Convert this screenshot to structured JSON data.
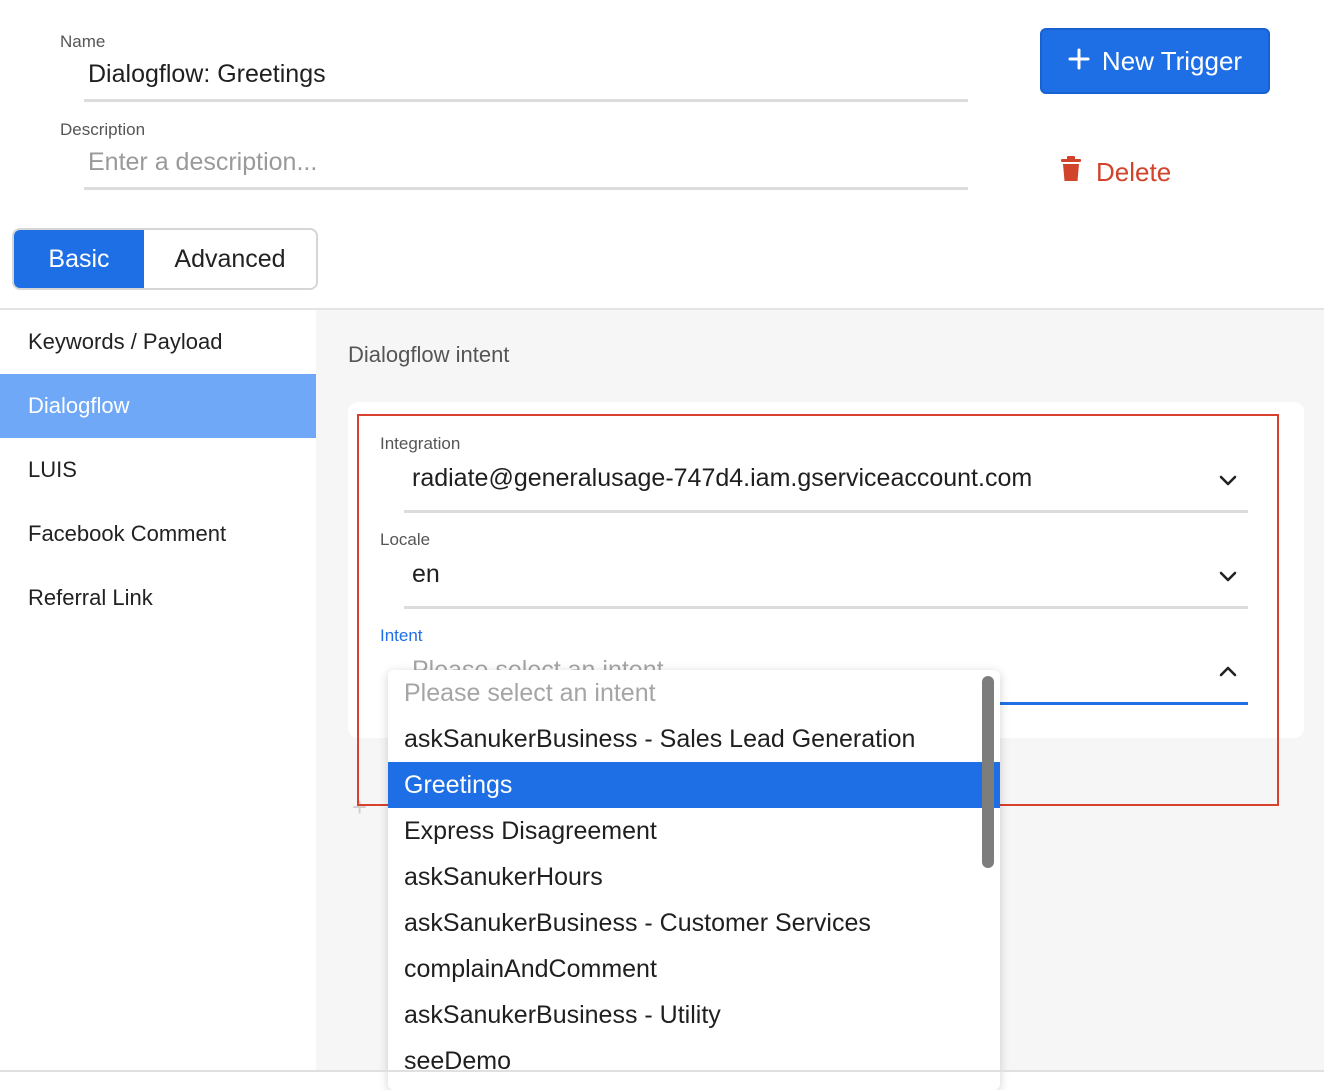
{
  "form": {
    "name_label": "Name",
    "name_value": "Dialogflow: Greetings",
    "description_label": "Description",
    "description_placeholder": "Enter a description..."
  },
  "actions": {
    "new_trigger_label": "New Trigger",
    "delete_label": "Delete"
  },
  "mode_tabs": {
    "basic": "Basic",
    "advanced": "Advanced",
    "selected": "Basic"
  },
  "sidebar": {
    "items": [
      {
        "label": "Keywords / Payload",
        "active": false
      },
      {
        "label": "Dialogflow",
        "active": true
      },
      {
        "label": "LUIS",
        "active": false
      },
      {
        "label": "Facebook Comment",
        "active": false
      },
      {
        "label": "Referral Link",
        "active": false
      }
    ]
  },
  "main": {
    "section_title": "Dialogflow intent",
    "integration": {
      "label": "Integration",
      "value": "radiate@generalusage-747d4.iam.gserviceaccount.com"
    },
    "locale": {
      "label": "Locale",
      "value": "en"
    },
    "intent": {
      "label": "Intent",
      "placeholder": "Please select an intent",
      "options": [
        "Please select an intent",
        "askSanukerBusiness - Sales Lead Generation",
        "Greetings",
        "Express Disagreement",
        "askSanukerHours",
        "askSanukerBusiness - Customer Services",
        "complainAndComment",
        "askSanukerBusiness - Utility",
        "seeDemo"
      ],
      "selected": "Greetings"
    }
  },
  "colors": {
    "primary": "#1e6fe6",
    "sidebar_active": "#6ea8f7",
    "danger": "#d1432b",
    "highlight_border": "#d9402e"
  },
  "icons": {
    "new_trigger": "plus-icon",
    "delete": "trash-icon",
    "select": "chevron-down-icon",
    "open_select": "chevron-up-icon"
  }
}
